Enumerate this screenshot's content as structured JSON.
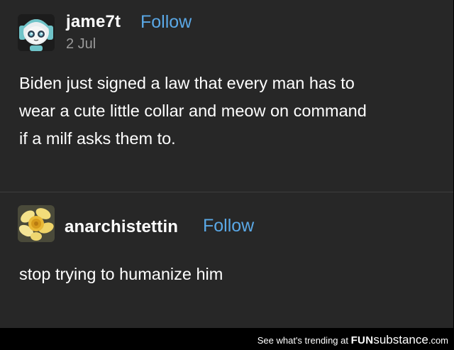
{
  "post": {
    "username": "jame7t",
    "follow_label": "Follow",
    "date": "2 Jul",
    "text": "Biden just signed a law that every man has to\nwear a cute little collar and meow on command\nif a milf asks them to."
  },
  "reply": {
    "username": "anarchistettin",
    "follow_label": "Follow",
    "text": "stop trying to humanize him"
  },
  "footer": {
    "prefix": "See what's trending at ",
    "brand_bold": "FUN",
    "brand_rest": "substance",
    "brand_suffix": ".com"
  },
  "colors": {
    "background": "#272727",
    "follow": "#5aa8e6",
    "date": "#9a9a9a"
  }
}
